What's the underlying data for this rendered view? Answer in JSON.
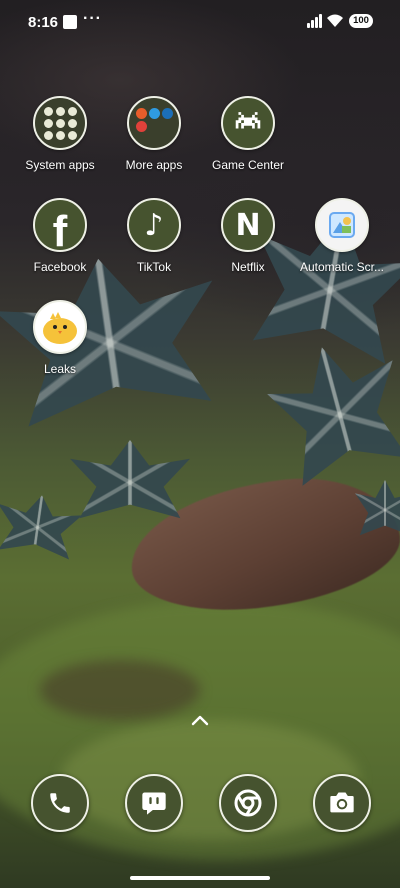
{
  "status_bar": {
    "time": "8:16",
    "more_indicator": "···",
    "battery": "100"
  },
  "apps": [
    {
      "label": "System apps",
      "icon": "folder-icon"
    },
    {
      "label": "More apps",
      "icon": "folder-icon"
    },
    {
      "label": "Game Center",
      "icon": "space-invader-icon"
    },
    {
      "label": "Facebook",
      "icon": "facebook-icon",
      "glyph": "f"
    },
    {
      "label": "TikTok",
      "icon": "music-note-icon",
      "glyph": "♪"
    },
    {
      "label": "Netflix",
      "icon": "netflix-icon",
      "glyph": "N"
    },
    {
      "label": "Automatic Scr...",
      "icon": "gallery-icon"
    },
    {
      "label": "Leaks",
      "icon": "chick-icon"
    }
  ],
  "dock": [
    {
      "name": "Phone",
      "icon": "phone-icon"
    },
    {
      "name": "Messages",
      "icon": "message-icon"
    },
    {
      "name": "Chrome",
      "icon": "chrome-icon"
    },
    {
      "name": "Camera",
      "icon": "camera-icon"
    }
  ],
  "colors": {
    "icon_bg": "#46532f",
    "icon_border": "#eef0e6",
    "folder_dots": [
      "#e85d2a",
      "#2f9be0",
      "#1c6fb8",
      "#e0413a"
    ]
  }
}
